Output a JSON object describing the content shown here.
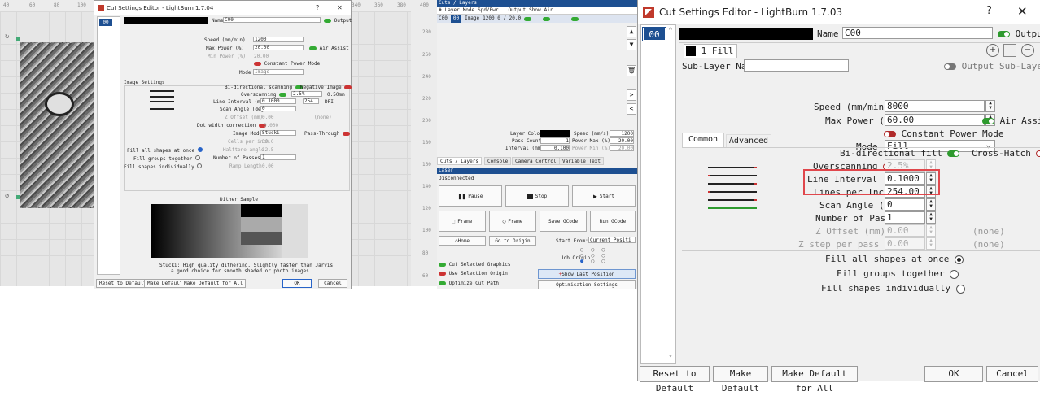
{
  "ruler": {
    "ticks": [
      "40",
      "60",
      "80",
      "100",
      "340",
      "360",
      "380",
      "400"
    ]
  },
  "small_editor": {
    "title": "Cut Settings Editor - LightBurn 1.7.04",
    "help": "?",
    "close": "✕",
    "layer_id": "00",
    "name_label": "Name",
    "name_value": "C00",
    "output_label": "Output",
    "speed_label": "Speed (mm/min)",
    "speed_value": "1200",
    "maxpower_label": "Max Power (%)",
    "maxpower_value": "20.00",
    "air_assist_label": "Air Assist",
    "minpower_label": "Min Power (%)",
    "minpower_value": "20.00",
    "constant_power_label": "Constant Power Mode",
    "mode_label": "Mode",
    "mode_value": "Image",
    "image_settings_label": "Image Settings",
    "bidir_label": "Bi-directional scanning",
    "negative_label": "Negative Image",
    "overscanning_label": "Overscanning",
    "overscanning_value": "2.5%",
    "overscanning_mm": "0.50mm",
    "line_interval_label": "Line Interval (mm)",
    "line_interval_value": "0.1000",
    "dpi_value": "254",
    "dpi_label": "DPI",
    "scan_angle_label": "Scan Angle (deg)",
    "scan_angle_value": "0",
    "z_offset_label": "Z Offset (mm)",
    "z_offset_value": "0.00",
    "z_offset_none": "(none)",
    "dot_width_label": "Dot width correction",
    "dot_width_value": "0.000",
    "image_mode_label": "Image Mode",
    "image_mode_value": "Stucki",
    "pass_through_label": "Pass-Through",
    "cells_label": "Cells per inch",
    "cells_value": "50.0",
    "halftone_label": "Halftone angle",
    "halftone_value": "22.5",
    "passes_label": "Number of Passes",
    "passes_value": "1",
    "ramp_label": "Ramp Length",
    "ramp_value": "0.00",
    "fill_all": "Fill all shapes at once",
    "fill_groups": "Fill groups together",
    "fill_indiv": "Fill shapes individually",
    "dither_label": "Dither Sample",
    "dither_desc1": "Stucki: High quality dithering. Slightly faster than Jarvis",
    "dither_desc2": "a good choice for smooth shaded or photo images",
    "btn_reset": "Reset to Default",
    "btn_make_default": "Make Default",
    "btn_make_default_all": "Make Default for All",
    "btn_ok": "OK",
    "btn_cancel": "Cancel"
  },
  "cuts_panel": {
    "title": "Cuts / Layers",
    "headers": [
      "#",
      "Layer",
      "Mode",
      "Spd/Pwr",
      "Output",
      "Show",
      "Air"
    ],
    "row": {
      "num": "C00",
      "layer": "00",
      "mode": "Image",
      "spdpwr": "1200.0 / 20.0"
    },
    "layer_color_label": "Layer Color",
    "speed_label": "Speed (mm/s)",
    "speed_value": "1200",
    "pass_count_label": "Pass Count",
    "pass_count_value": "1",
    "power_max_label": "Power Max (%)",
    "power_max_value": "20.00",
    "interval_label": "Interval (mm)",
    "interval_value": "0.100",
    "power_min_label": "Power Min (%)",
    "power_min_value": "20.00",
    "tabs": [
      "Cuts / Layers",
      "Console",
      "Camera Control",
      "Variable Text"
    ],
    "scroll_up": "▲",
    "scroll_down": "▼",
    "trash": "🗑",
    "arrow_right": ">",
    "arrow_left": "<",
    "vruler": [
      "280",
      "260",
      "240",
      "220",
      "200",
      "180",
      "160",
      "140",
      "120",
      "100",
      "80",
      "60"
    ]
  },
  "laser_panel": {
    "title": "Laser",
    "status": "Disconnected",
    "pause": "Pause",
    "stop": "Stop",
    "start": "Start",
    "frame1": "Frame",
    "frame2": "Frame",
    "save_gcode": "Save GCode",
    "run_gcode": "Run GCode",
    "home": "Home",
    "goto_origin": "Go to Origin",
    "start_from_label": "Start From:",
    "start_from_value": "Current Positi",
    "job_origin_label": "Job Origin",
    "cut_selected": "Cut Selected Graphics",
    "use_selection_origin": "Use Selection Origin",
    "optimize_cut": "Optimize Cut Path",
    "show_last_position": "Show Last Position",
    "optimisation_settings": "Optimisation Settings"
  },
  "big_editor": {
    "title": "Cut Settings Editor - LightBurn 1.7.03",
    "help": "?",
    "close": "✕",
    "layer_id": "00",
    "name_label": "Name",
    "name_value": "C00",
    "output_label": "Output",
    "sublayer_tab": "1 Fill",
    "sublayer_name_label": "Sub-Layer Name",
    "sublayer_name_value": "",
    "output_sublayer_label": "Output Sub-Layer",
    "speed_label": "Speed (mm/min)",
    "speed_value": "8000",
    "maxpower_label": "Max Power (%)",
    "maxpower_value": "60.00",
    "air_assist_label": "Air Assist",
    "constant_power_label": "Constant Power Mode",
    "mode_label": "Mode",
    "mode_value": "Fill",
    "tab_common": "Common",
    "tab_advanced": "Advanced",
    "bidir_label": "Bi-directional fill",
    "crosshatch_label": "Cross-Hatch",
    "overscanning_label": "Overscanning",
    "overscanning_value": "2.5%",
    "line_interval_label": "Line Interval (mm)",
    "line_interval_value": "0.1000",
    "lpi_label": "Lines per Inch",
    "lpi_value": "254.00",
    "scan_angle_label": "Scan Angle (deg)",
    "scan_angle_value": "0",
    "passes_label": "Number of Passes",
    "passes_value": "1",
    "z_offset_label": "Z Offset (mm)",
    "z_offset_value": "0.00",
    "z_offset_none": "(none)",
    "z_step_label": "Z step per pass (mm)",
    "z_step_value": "0.00",
    "z_step_none": "(none)",
    "fill_all": "Fill all shapes at once",
    "fill_groups": "Fill groups together",
    "fill_indiv": "Fill shapes individually",
    "btn_reset": "Reset to Default",
    "btn_make_default": "Make Default",
    "btn_make_default_all": "Make Default for All",
    "btn_ok": "OK",
    "btn_cancel": "Cancel",
    "icon_add": "+",
    "icon_remove": "−",
    "scroll_up": "⌃",
    "scroll_down": "⌄",
    "spin_up": "▲",
    "spin_down": "▼",
    "dropdown": "⌄"
  }
}
